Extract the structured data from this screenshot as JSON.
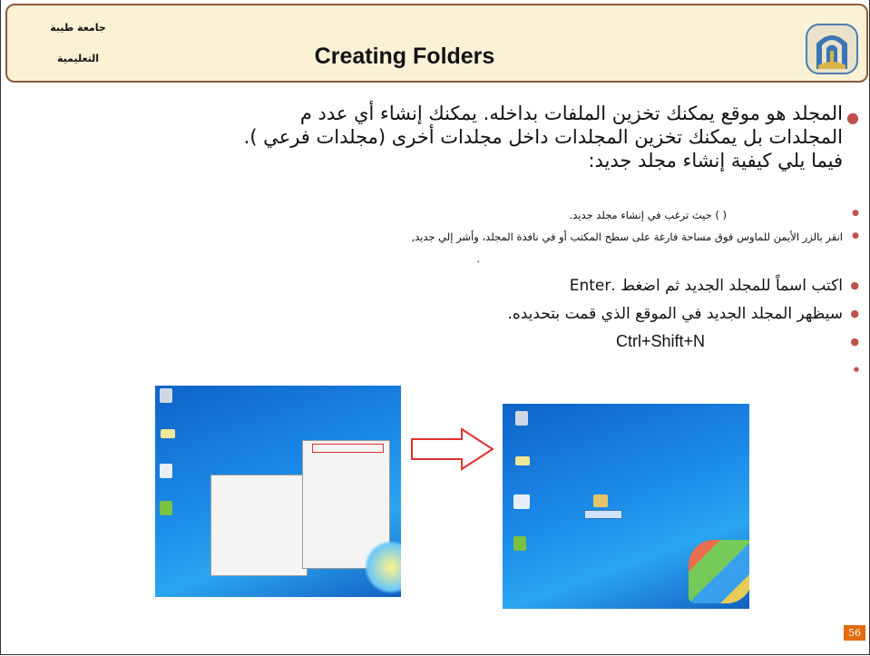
{
  "header": {
    "university_line1": "جامعة طيبة",
    "university_line2": "التعليمية",
    "title": "Creating Folders",
    "logo_icon": "university-emblem-icon"
  },
  "bullets": {
    "main_line1": "المجلد هو موقع يمكنك تخزين الملفات بداخله. يمكنك إنشاء أي عدد م",
    "main_line2": "المجلدات بل يمكنك تخزين المجلدات داخل مجلدات أخرى (مجلدات فرعي ).",
    "main_line3": "فيما يلي كيفية إنشاء مجلد جديد:",
    "step1": "(                              ) حيث ترغب في إنشاء مجلد جديد.",
    "step2": "انقر بالزر الأيمن للماوس فوق مساحة فارغة على سطح المكتب أو في نافذة المجلد، وأشر إلي جديد,",
    "step2_cont": ".",
    "step3": "اكتب اسماً للمجلد الجديد ثم اضغط .Enter",
    "step4": "سيظهر المجلد الجديد في الموقع الذي قمت بتحديده.",
    "step5": "Ctrl+Shift+N"
  },
  "figure": {
    "arrow_icon": "right-arrow-icon",
    "screenshot_before": "desktop-context-menu-screenshot",
    "screenshot_after": "desktop-new-folder-screenshot"
  },
  "page_number": "56",
  "colors": {
    "header_bg": "#fbf1d5",
    "header_border": "#8d5a3b",
    "bullet": "#c0504d",
    "arrow": "#e03030",
    "page_badge": "#e26b0a"
  }
}
